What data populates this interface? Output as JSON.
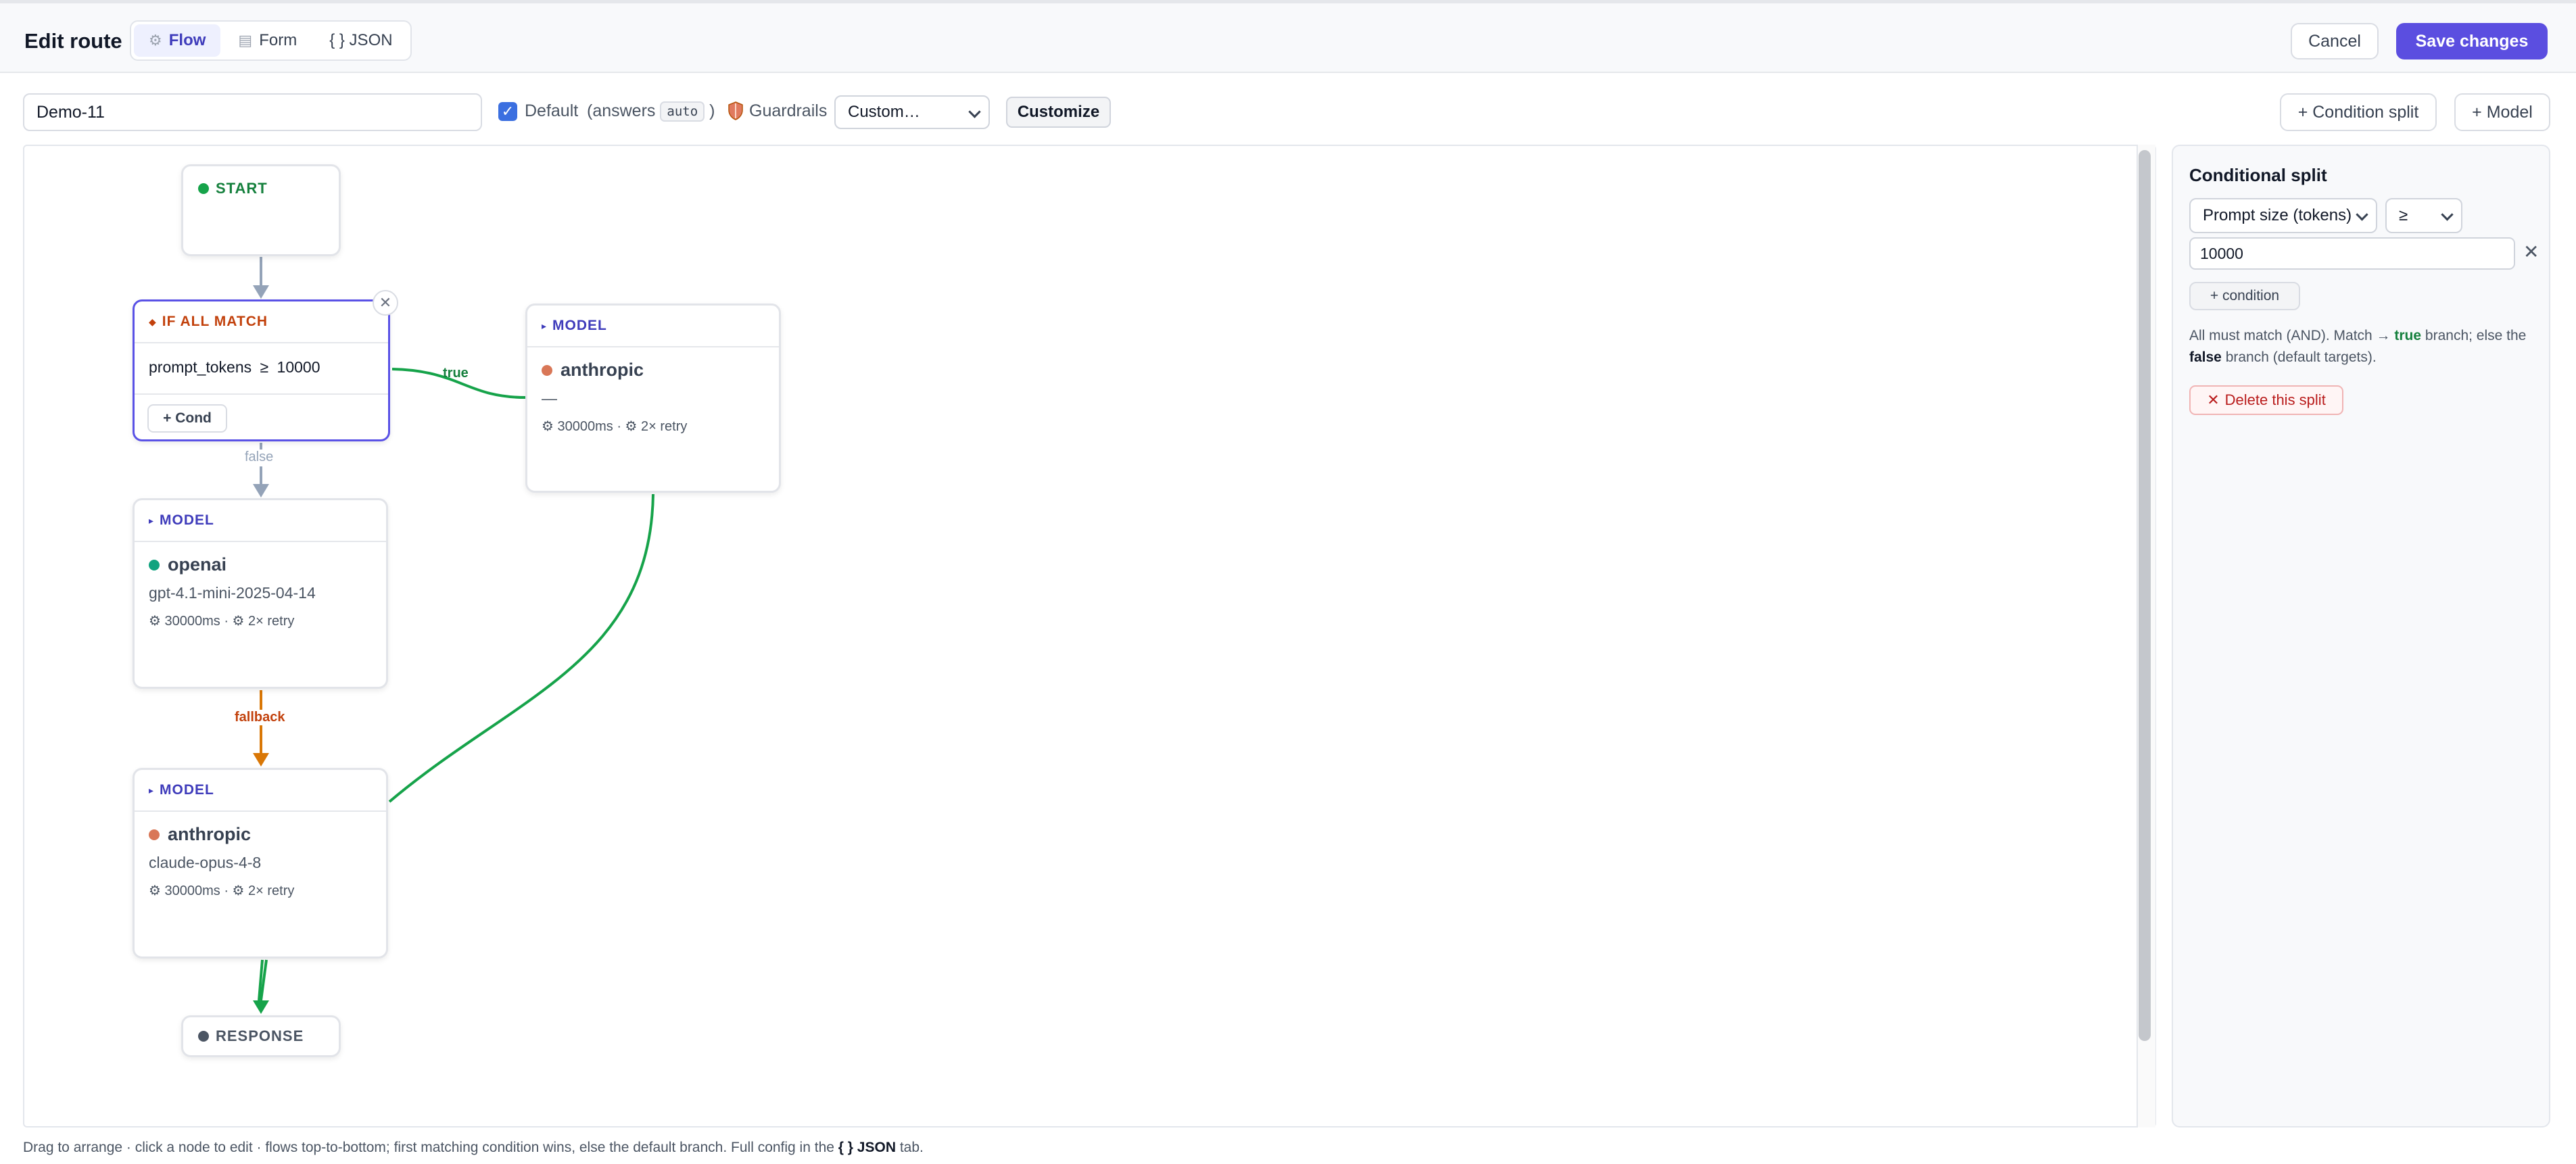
{
  "header": {
    "title": "Edit route",
    "modes": [
      {
        "label": "Flow",
        "icon": "flow-icon",
        "active": true
      },
      {
        "label": "Form",
        "icon": "form-icon",
        "active": false
      },
      {
        "label": "{ } JSON",
        "icon": "",
        "active": false
      }
    ],
    "cancel_label": "Cancel",
    "save_label": "Save changes"
  },
  "toolbar": {
    "route_name": "Demo-11",
    "default_checked": true,
    "default_label": "Default",
    "answers_prefix": "(answers",
    "answers_code": "auto",
    "answers_suffix": ")",
    "guardrails_label": "Guardrails",
    "guardrails_value": "Custom…",
    "customize_label": "Customize",
    "add_condition_split": "+ Condition split",
    "add_model": "+ Model"
  },
  "flow": {
    "start_label": "START",
    "condition": {
      "kind": "IF ALL MATCH",
      "field": "prompt_tokens",
      "operator": "≥",
      "value": "10000",
      "add_label": "+ Cond",
      "remove_icon": "close-icon"
    },
    "edge_true": "true",
    "edge_false": "false",
    "edge_fallback": "fallback",
    "models": [
      {
        "id": "anth1",
        "kind": "MODEL",
        "provider": "anthropic",
        "dot_color": "#d97757",
        "model": "—",
        "meta": "⚙ 30000ms · ⚙ 2× retry"
      },
      {
        "id": "openai",
        "kind": "MODEL",
        "provider": "openai",
        "dot_color": "#10a37f",
        "model": "gpt-4.1-mini-2025-04-14",
        "meta": "⚙ 30000ms · ⚙ 2× retry"
      },
      {
        "id": "anth2",
        "kind": "MODEL",
        "provider": "anthropic",
        "dot_color": "#d97757",
        "model": "claude-opus-4-8",
        "meta": "⚙ 30000ms · ⚙ 2× retry"
      }
    ],
    "response_label": "RESPONSE"
  },
  "colors": {
    "accent": "#5b4ee0",
    "true_edge": "#16a34a",
    "false_edge": "#94a3b8",
    "fallback_edge": "#d97706"
  },
  "panel": {
    "title": "Conditional split",
    "field_value": "Prompt size (tokens)",
    "operator_value": "≥",
    "threshold_value": "10000",
    "add_condition": "+ condition",
    "help_1": "All must match (AND). Match → ",
    "help_true": "true",
    "help_2": " branch; else the ",
    "help_false": "false",
    "help_3": " branch (default targets).",
    "delete_label": "Delete this split"
  },
  "footer": {
    "hint_prefix": "Drag to arrange · click a node to edit · flows top-to-bottom; first matching condition wins, else the default branch. Full config in the ",
    "hint_bold": "{ } JSON",
    "hint_suffix": " tab."
  }
}
